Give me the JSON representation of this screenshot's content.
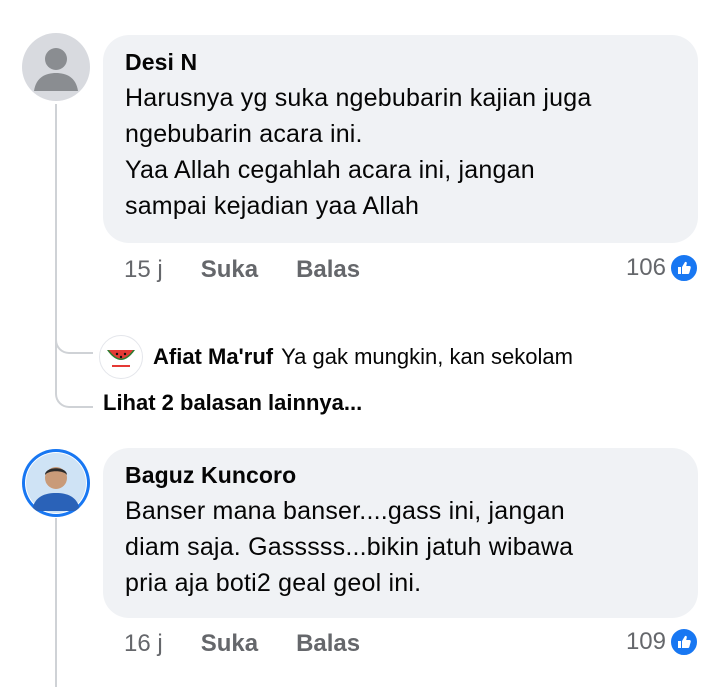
{
  "comments": [
    {
      "author": "Desi N",
      "lines": [
        "Harusnya yg suka ngebubarin kajian juga",
        "ngebubarin acara ini.",
        "Yaa Allah cegahlah acara ini, jangan",
        "sampai kejadian yaa Allah"
      ],
      "time": "15 j",
      "like_label": "Suka",
      "reply_label": "Balas",
      "like_count": "106"
    },
    {
      "author": "Baguz Kuncoro",
      "lines": [
        "Banser mana banser....gass ini, jangan",
        "diam saja. Gasssss...bikin jatuh wibawa",
        "pria aja boti2 geal geol ini."
      ],
      "time": "16 j",
      "like_label": "Suka",
      "reply_label": "Balas",
      "like_count": "109"
    }
  ],
  "reply": {
    "author": "Afiat Ma'ruf",
    "text": "Ya gak mungkin, kan sekolam"
  },
  "more_replies_label": "Lihat 2 balasan lainnya...",
  "colors": {
    "bubble": "#f0f2f5",
    "like_blue": "#1877f2",
    "meta_gray": "#65676b"
  },
  "icons": [
    "default-avatar-icon",
    "watermelon-avatar",
    "profile-photo-avatar",
    "like-thumb-icon"
  ]
}
